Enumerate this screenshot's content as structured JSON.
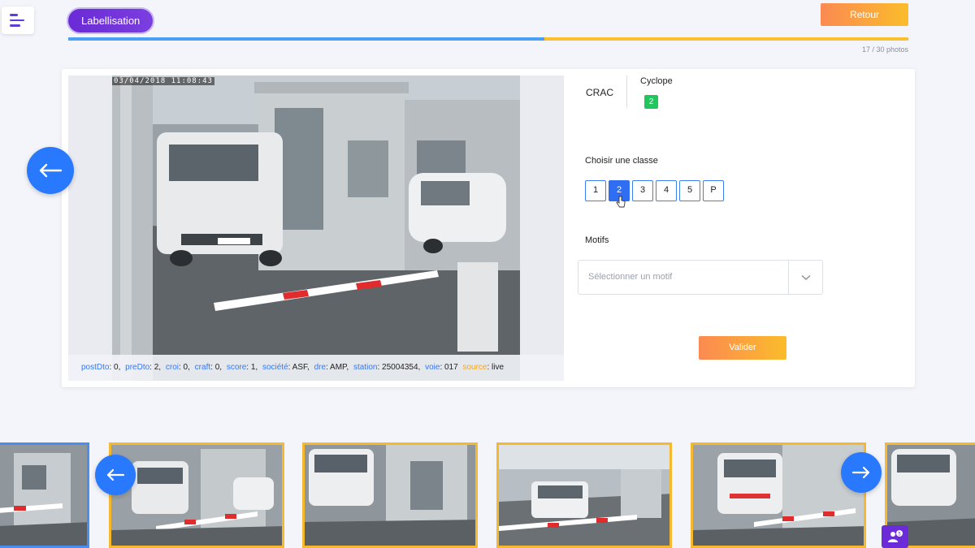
{
  "header": {
    "title": "Labellisation",
    "back_label": "Retour",
    "progress": {
      "current": 17,
      "total": 30,
      "fraction": 0.567
    },
    "photo_count": "17 / 30 photos"
  },
  "photo": {
    "timestamp": "03/04/2018 11:08:43",
    "meta": [
      {
        "key": "postDto",
        "value": "0,"
      },
      {
        "key": "preDto",
        "value": "2,"
      },
      {
        "key": "croi",
        "value": "0,"
      },
      {
        "key": "craft",
        "value": "0,"
      },
      {
        "key": "score",
        "value": "1,"
      },
      {
        "key": "société",
        "value": "ASF,"
      },
      {
        "key": "dre",
        "value": "AMP,"
      },
      {
        "key": "station",
        "value": "25004354,"
      },
      {
        "key": "voie",
        "value": "017"
      },
      {
        "key": "source",
        "value": "live"
      }
    ]
  },
  "info": {
    "crac_label": "CRAC",
    "cyclope_label": "Cyclope",
    "cyclope_value": "2"
  },
  "classes": {
    "label": "Choisir une classe",
    "options": [
      "1",
      "2",
      "3",
      "4",
      "5",
      "P"
    ],
    "selected": "2"
  },
  "motifs": {
    "label": "Motifs",
    "placeholder": "Sélectionner un motif"
  },
  "validate_label": "Valider",
  "fab_badge": "5",
  "colors": {
    "accent_blue": "#2979ff",
    "accent_purple": "#6a2ad6",
    "orange_start": "#fb8a52",
    "orange_end": "#fbbc2b",
    "badge_green": "#22c55e",
    "thumb_border": "#f5b82e",
    "thumb_active_border": "#4a8ff0"
  },
  "icons": {
    "menu": "hamburger-icon",
    "prev": "arrow-left-icon",
    "next": "arrow-right-icon",
    "dropdown": "chevron-down-icon",
    "fab": "users-icon"
  }
}
